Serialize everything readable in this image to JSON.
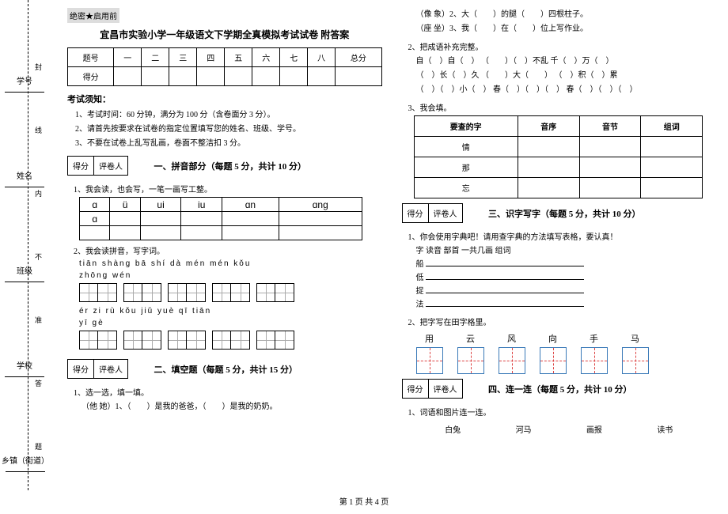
{
  "secret_label": "绝密★启用前",
  "title": "宜昌市实验小学一年级语文下学期全真模拟考试试卷 附答案",
  "score_header": {
    "row_label": "题号",
    "cols": [
      "一",
      "二",
      "三",
      "四",
      "五",
      "六",
      "七",
      "八",
      "总分"
    ],
    "score_label": "得分"
  },
  "notice_title": "考试须知：",
  "notices": [
    "1、考试时间：60 分钟，满分为 100 分（含卷面分 3 分）。",
    "2、请首先按要求在试卷的指定位置填写您的姓名、班级、学号。",
    "3、不要在试卷上乱写乱画，卷面不整洁扣 3 分。"
  ],
  "scorebox": {
    "left": "得分",
    "right": "评卷人"
  },
  "s1": {
    "title": "一、拼音部分（每题 5 分，共计 10 分）",
    "q1": "1、我会读，也会写，一笔一画写工整。",
    "syl_top": [
      "ɑ",
      "ü",
      "ui",
      "iu",
      "ɑn",
      "ɑng"
    ],
    "syl_first": "ɑ",
    "q2": "2、我会读拼音，写字词。",
    "py_a": "tiān shàng        bā shí                    dà mén              mén kǒu",
    "py_a2": "zhōng wén",
    "py_b": "ér  zi        rù  kǒu           jiǔ  yuè             qī   tiān",
    "py_b2": "yī  gè"
  },
  "s2": {
    "title": "二、填空题（每题 5 分，共计 15 分）",
    "q1": "1、选一选，填一填。",
    "line1": "（他 她）1、（　　）是我的爸爸，（　　）是我的奶奶。",
    "line2": "（像 象）2、大（　　）的腿（　　）四根柱子。",
    "line3": "（座 坐）3、我（　　）在（　　）位上写作业。",
    "q2": "2、把成语补充完整。",
    "idiom1": "自（　）自（　）    （　　）（　）不乱      千（　）万（　）",
    "idiom2": "（　）长（　）久    （　　）大（　　）     （　）积（　）累",
    "idiom3": "（　）（　）小（　）   春（　）（　）（　）   春（　）（　）（　）",
    "q3": "3、我会填。",
    "table_headers": [
      "要查的字",
      "音序",
      "音节",
      "组词"
    ],
    "table_chars": [
      "情",
      "那",
      "忘"
    ]
  },
  "s3": {
    "title": "三、识字写字（每题 5 分，共计 10 分）",
    "q1": "1、你会使用字典吧！请用查字典的方法填写表格，要认真！",
    "dict_header": "字      读音        部首        一共几画        组词",
    "dict_chars": [
      "船",
      "低",
      "捉",
      "法"
    ],
    "q2": "2、把字写在田字格里。",
    "hanzi": [
      "用",
      "云",
      "风",
      "向",
      "手",
      "马"
    ]
  },
  "s4": {
    "title": "四、连一连（每题 5 分，共计 10 分）",
    "q1": "1、词语和图片连一连。",
    "words": [
      "白兔",
      "河马",
      "画报",
      "读书"
    ]
  },
  "margin": {
    "xiangzhen": "乡镇（街道）",
    "xuexiao": "学校",
    "banji": "班级",
    "xingming": "姓名",
    "xuehao": "学号",
    "feng": "封",
    "xian": "线",
    "nei": "内",
    "bu": "不",
    "zhun": "准",
    "da": "答",
    "ti": "题"
  },
  "footer": "第 1 页 共 4 页"
}
